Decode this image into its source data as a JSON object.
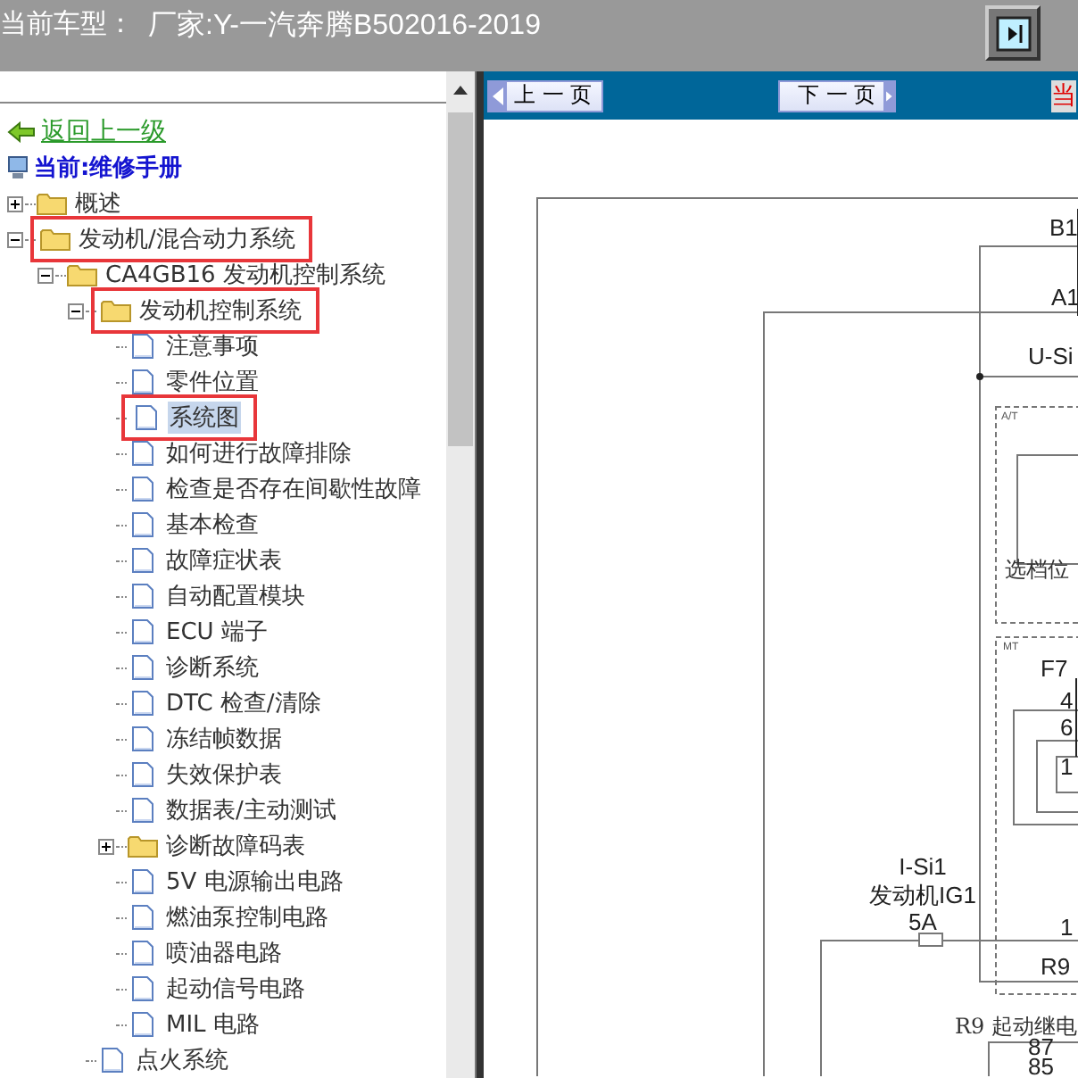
{
  "header": {
    "model_label": "当前车型：",
    "model_value": "厂家:Y-一汽奔腾B502016-2019"
  },
  "back_link": "返回上一级",
  "current": "当前:维修手册",
  "tree": [
    {
      "label": "概述",
      "kind": "folder",
      "expanded": false,
      "selected": false,
      "highlighted": false
    },
    {
      "label": "发动机/混合动力系统",
      "kind": "folder",
      "expanded": true,
      "selected": false,
      "highlighted": true,
      "children": [
        {
          "label": "CA4GB16 发动机控制系统",
          "kind": "folder",
          "expanded": true,
          "selected": false,
          "highlighted": false,
          "children": [
            {
              "label": "发动机控制系统",
              "kind": "folder",
              "expanded": true,
              "selected": false,
              "highlighted": true,
              "children": [
                {
                  "label": "注意事项",
                  "kind": "doc",
                  "selected": false,
                  "highlighted": false
                },
                {
                  "label": "零件位置",
                  "kind": "doc",
                  "selected": false,
                  "highlighted": false
                },
                {
                  "label": "系统图",
                  "kind": "doc",
                  "selected": true,
                  "highlighted": true
                },
                {
                  "label": "如何进行故障排除",
                  "kind": "doc",
                  "selected": false,
                  "highlighted": false
                },
                {
                  "label": "检查是否存在间歇性故障",
                  "kind": "doc",
                  "selected": false,
                  "highlighted": false
                },
                {
                  "label": "基本检查",
                  "kind": "doc",
                  "selected": false,
                  "highlighted": false
                },
                {
                  "label": "故障症状表",
                  "kind": "doc",
                  "selected": false,
                  "highlighted": false
                },
                {
                  "label": "自动配置模块",
                  "kind": "doc",
                  "selected": false,
                  "highlighted": false
                },
                {
                  "label": "ECU 端子",
                  "kind": "doc",
                  "selected": false,
                  "highlighted": false
                },
                {
                  "label": "诊断系统",
                  "kind": "doc",
                  "selected": false,
                  "highlighted": false
                },
                {
                  "label": "DTC 检查/清除",
                  "kind": "doc",
                  "selected": false,
                  "highlighted": false
                },
                {
                  "label": "冻结帧数据",
                  "kind": "doc",
                  "selected": false,
                  "highlighted": false
                },
                {
                  "label": "失效保护表",
                  "kind": "doc",
                  "selected": false,
                  "highlighted": false
                },
                {
                  "label": "数据表/主动测试",
                  "kind": "doc",
                  "selected": false,
                  "highlighted": false
                },
                {
                  "label": "诊断故障码表",
                  "kind": "folder",
                  "expanded": false,
                  "selected": false,
                  "highlighted": false
                },
                {
                  "label": "5V 电源输出电路",
                  "kind": "doc",
                  "selected": false,
                  "highlighted": false
                },
                {
                  "label": "燃油泵控制电路",
                  "kind": "doc",
                  "selected": false,
                  "highlighted": false
                },
                {
                  "label": "喷油器电路",
                  "kind": "doc",
                  "selected": false,
                  "highlighted": false
                },
                {
                  "label": "起动信号电路",
                  "kind": "doc",
                  "selected": false,
                  "highlighted": false
                },
                {
                  "label": "MIL 电路",
                  "kind": "doc",
                  "selected": false,
                  "highlighted": false
                }
              ]
            },
            {
              "label": "点火系统",
              "kind": "doc",
              "selected": false,
              "highlighted": false
            }
          ]
        }
      ]
    }
  ],
  "nav": {
    "prev": "上 一 页",
    "next": "下 一 页",
    "current": "当"
  },
  "diagram": {
    "labels": [
      "B1",
      "A1",
      "U-Si",
      "A/T",
      "选档位",
      "MT",
      "F7",
      "4",
      "6",
      "1",
      "I-Si1",
      "发动机IG1",
      "5A",
      "1",
      "R9",
      "R9 起动继电",
      "87",
      "85"
    ]
  }
}
